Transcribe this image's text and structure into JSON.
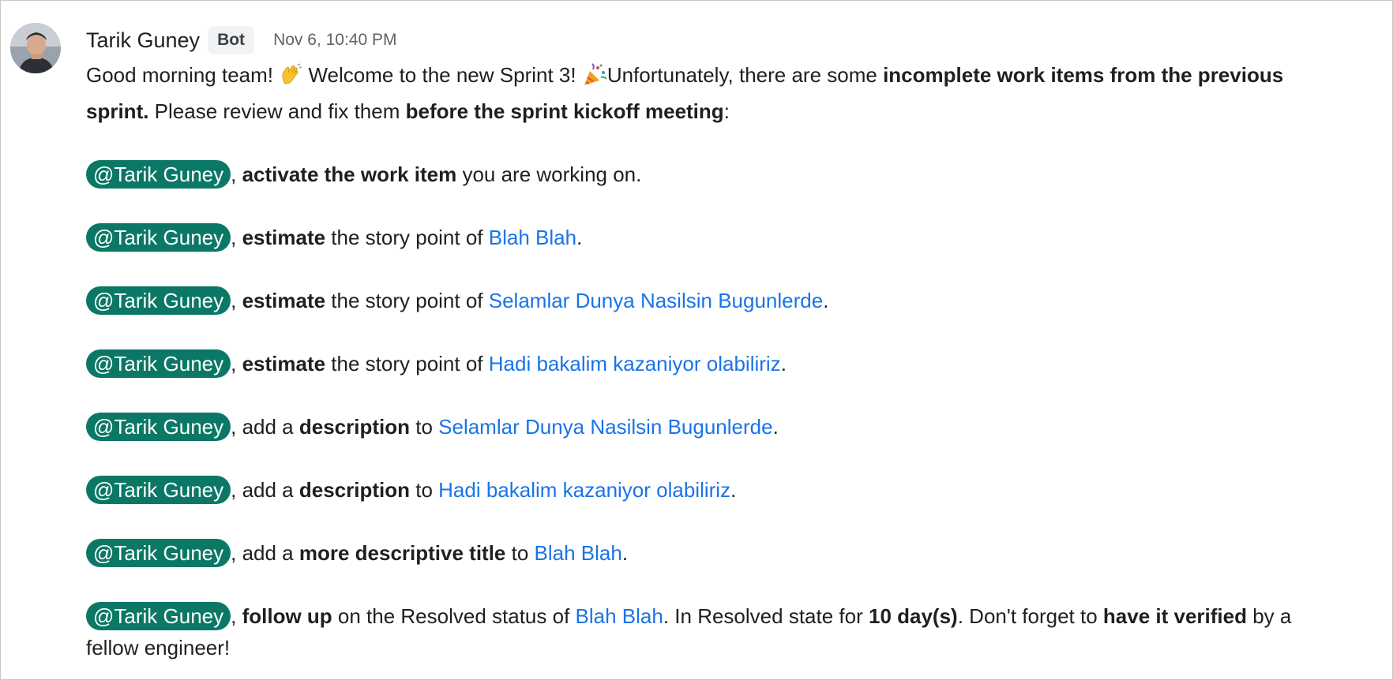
{
  "message": {
    "sender": "Tarik Guney",
    "badge": "Bot",
    "timestamp": "Nov 6, 10:40 PM",
    "intro": {
      "p1": "Good morning team! ",
      "p2": " Welcome to the new Sprint 3! ",
      "p3": "Unfortunately, there are some ",
      "b1": "incomplete work items from the previous sprint.",
      "p4": " Please review and fix them ",
      "b2": "before the sprint kickoff meeting",
      "p5": ":"
    },
    "mention": "@Tarik Guney",
    "items": [
      {
        "sep": ", ",
        "bold": "activate the work item",
        "text": " you are working on."
      },
      {
        "sep": ", ",
        "bold": "estimate",
        "text": " the story point of ",
        "link": "Blah Blah",
        "end": "."
      },
      {
        "sep": ", ",
        "bold": "estimate",
        "text": " the story point of ",
        "link": "Selamlar Dunya Nasilsin Bugunlerde",
        "end": "."
      },
      {
        "sep": ", ",
        "bold": "estimate",
        "text": " the story point of ",
        "link": "Hadi bakalim kazaniyor olabiliriz",
        "end": "."
      },
      {
        "pre": ", add a ",
        "bold": "description",
        "text": " to ",
        "link": "Selamlar Dunya Nasilsin Bugunlerde",
        "end": "."
      },
      {
        "pre": ", add a ",
        "bold": "description",
        "text": " to ",
        "link": "Hadi bakalim kazaniyor olabiliriz",
        "end": "."
      },
      {
        "pre": ", add a ",
        "bold": "more descriptive title",
        "text": " to ",
        "link": "Blah Blah",
        "end": "."
      },
      {
        "sep": ", ",
        "bold": "follow up",
        "text": " on the Resolved status of ",
        "link": "Blah Blah",
        "t2": ". In Resolved state for ",
        "b2": "10 day(s)",
        "t3": ". Don't forget to ",
        "b3": "have it verified",
        "t4": " by a fellow engineer!"
      }
    ]
  },
  "icons": {
    "avatar": "user-avatar-photo",
    "wave": "waving-hand-emoji",
    "party": "party-popper-emoji"
  },
  "colors": {
    "mention_bg": "#0b7866",
    "link": "#1a73e8",
    "badge_bg": "#f1f3f4"
  }
}
